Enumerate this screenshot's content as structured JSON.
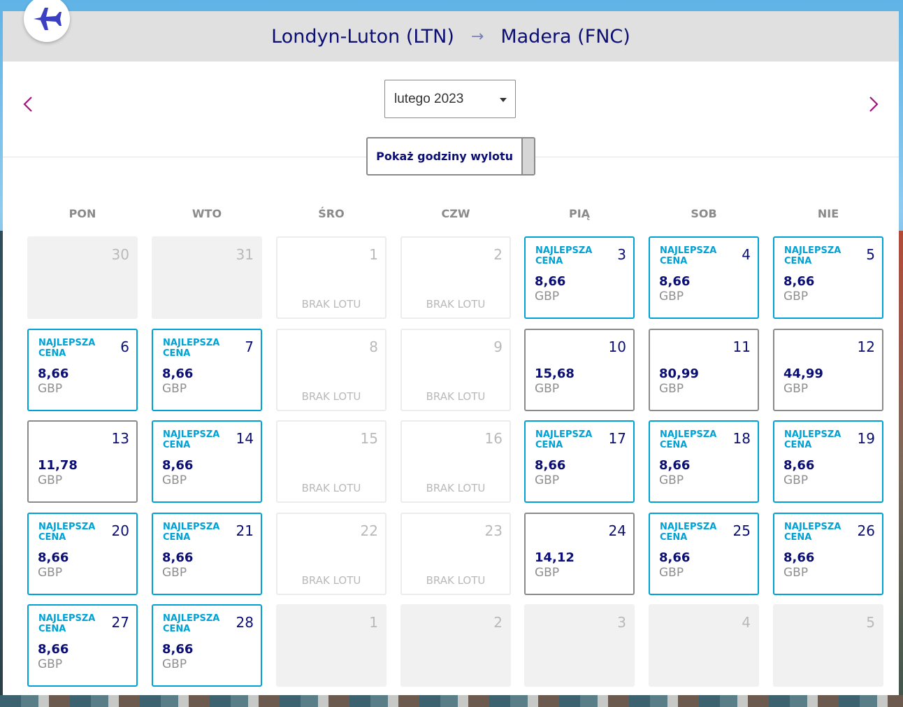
{
  "route": {
    "origin": "Londyn-Luton (LTN)",
    "arrow": "→",
    "destination": "Madera (FNC)"
  },
  "month_select": {
    "value": "lutego 2023"
  },
  "toggle_button": {
    "label": "Pokaż godziny wylotu"
  },
  "weekdays": [
    "PON",
    "WTO",
    "ŚRO",
    "CZW",
    "PIĄ",
    "SOB",
    "NIE"
  ],
  "labels": {
    "best": "NAJLEPSZA CENA",
    "no_flight": "BRAK LOTU",
    "currency": "GBP"
  },
  "colors": {
    "brand": "#0b0e73",
    "best_price": "#00a2d6",
    "muted": "#8a8a8a"
  },
  "days": [
    {
      "day": "30",
      "status": "outside"
    },
    {
      "day": "31",
      "status": "outside"
    },
    {
      "day": "1",
      "status": "noflight"
    },
    {
      "day": "2",
      "status": "noflight"
    },
    {
      "day": "3",
      "status": "best",
      "price": "8,66"
    },
    {
      "day": "4",
      "status": "best",
      "price": "8,66"
    },
    {
      "day": "5",
      "status": "best",
      "price": "8,66"
    },
    {
      "day": "6",
      "status": "best",
      "price": "8,66"
    },
    {
      "day": "7",
      "status": "best",
      "price": "8,66"
    },
    {
      "day": "8",
      "status": "noflight"
    },
    {
      "day": "9",
      "status": "noflight"
    },
    {
      "day": "10",
      "status": "normal",
      "price": "15,68"
    },
    {
      "day": "11",
      "status": "normal",
      "price": "80,99"
    },
    {
      "day": "12",
      "status": "normal",
      "price": "44,99"
    },
    {
      "day": "13",
      "status": "normal",
      "price": "11,78"
    },
    {
      "day": "14",
      "status": "best",
      "price": "8,66"
    },
    {
      "day": "15",
      "status": "noflight"
    },
    {
      "day": "16",
      "status": "noflight"
    },
    {
      "day": "17",
      "status": "best",
      "price": "8,66"
    },
    {
      "day": "18",
      "status": "best",
      "price": "8,66"
    },
    {
      "day": "19",
      "status": "best",
      "price": "8,66"
    },
    {
      "day": "20",
      "status": "best",
      "price": "8,66"
    },
    {
      "day": "21",
      "status": "best",
      "price": "8,66"
    },
    {
      "day": "22",
      "status": "noflight"
    },
    {
      "day": "23",
      "status": "noflight"
    },
    {
      "day": "24",
      "status": "normal",
      "price": "14,12"
    },
    {
      "day": "25",
      "status": "best",
      "price": "8,66"
    },
    {
      "day": "26",
      "status": "best",
      "price": "8,66"
    },
    {
      "day": "27",
      "status": "best",
      "price": "8,66"
    },
    {
      "day": "28",
      "status": "best",
      "price": "8,66"
    },
    {
      "day": "1",
      "status": "outside"
    },
    {
      "day": "2",
      "status": "outside"
    },
    {
      "day": "3",
      "status": "outside"
    },
    {
      "day": "4",
      "status": "outside"
    },
    {
      "day": "5",
      "status": "outside"
    }
  ]
}
